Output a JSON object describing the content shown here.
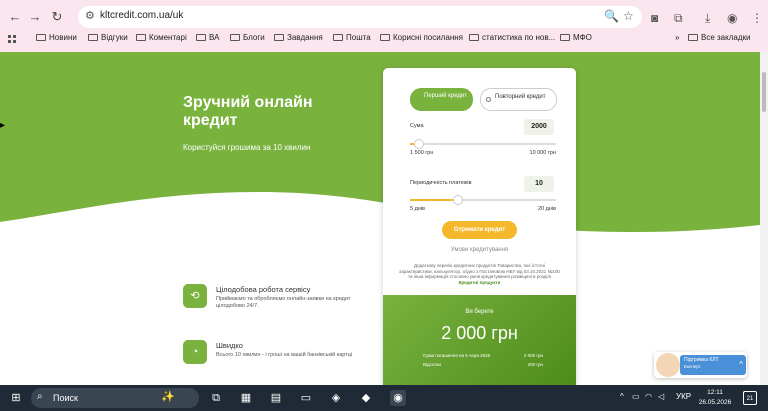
{
  "browser": {
    "url": "kltcredit.com.ua/uk",
    "bookmarks": [
      "Новини",
      "Відгуки",
      "Коментарі",
      "ВА",
      "Блоги",
      "Завдання",
      "Пошта",
      "Корисні посилання",
      "статистика по нов...",
      "МФО"
    ],
    "all_bookmarks_label": "Все закладки",
    "more_label": "»"
  },
  "hero": {
    "title": "Зручний онлайн кредит",
    "subtitle": "Користуйся грошима за 10 хвилин"
  },
  "features": [
    {
      "title": "Цілодобова робота сервісу",
      "desc": "Приймаємо та обробляємо онлайн-заявки на кредит цілодобово 24/7.",
      "icon": "clock-24-icon"
    },
    {
      "title": "Швидко",
      "desc": "Всього 10 хвилин - і гроші на вашій банківській картці",
      "icon": "timer-icon"
    }
  ],
  "calculator": {
    "tab_first": "Перший кредит",
    "tab_repeat": "Повторний кредит",
    "amount_label": "Сума",
    "amount_value": "2000",
    "amount_min": "1 500 грн",
    "amount_max": "10 000 грн",
    "amount_fraction": 0.06,
    "period_label": "Периодичність платежів",
    "period_value": "10",
    "period_min": "5 днів",
    "period_max": "20 днів",
    "period_fraction": 0.33,
    "cta_label": "Отримати кредит",
    "terms_label": "Умови кредитування",
    "fine_print": "Додаткову перелік кредитних продуктів Товариства, їхні істотні характеристики, калькулятор, згідно з Постановою НБУ від 03.10.2021 №100 та інша інформація стосовно умов кредитування розміщені в розділі",
    "fine_link": "Кредитні продукти",
    "result_get_label": "Ви берете",
    "result_amount": "2 000 грн",
    "result_row1_label": "Сума погашення на 5 чера 2026",
    "result_row1_value": "2 000 грн",
    "result_row2_label": "Відсотки",
    "result_row2_value": "200 грн"
  },
  "support": {
    "title": "Підтримка КЛТ",
    "subtitle": "Експерт",
    "chevron": "^"
  },
  "taskbar": {
    "search_placeholder": "Поиск",
    "lang": "УКР",
    "time": "12:11",
    "date": "26.05.2026",
    "notif_count": "21"
  },
  "colors": {
    "brand_green": "#7ab23e",
    "accent_yellow": "#f6b82b",
    "chrome_bg": "#fbe6ef",
    "taskbar_bg": "#1f2a36"
  }
}
